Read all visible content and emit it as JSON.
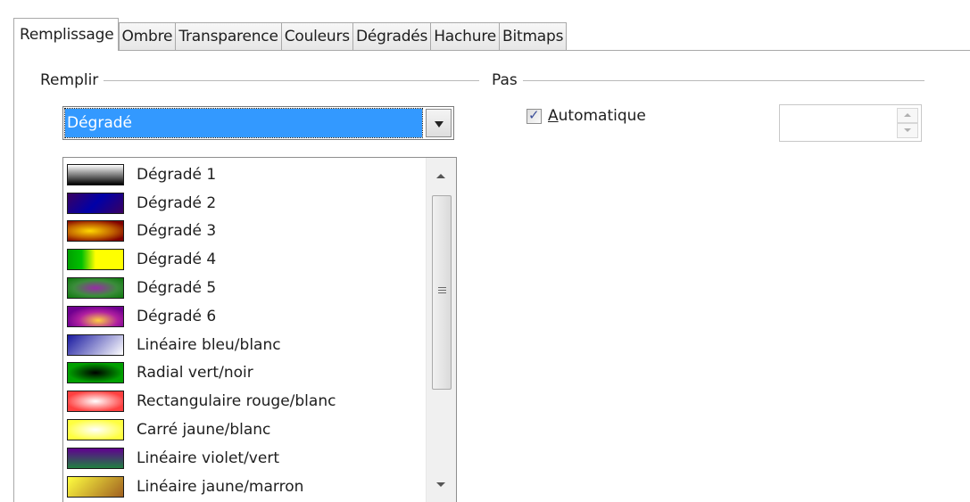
{
  "tabs": [
    {
      "label": "Remplissage",
      "active": true
    },
    {
      "label": "Ombre",
      "active": false
    },
    {
      "label": "Transparence",
      "active": false
    },
    {
      "label": "Couleurs",
      "active": false
    },
    {
      "label": "Dégradés",
      "active": false
    },
    {
      "label": "Hachure",
      "active": false
    },
    {
      "label": "Bitmaps",
      "active": false
    }
  ],
  "fill": {
    "section_label": "Remplir",
    "selected": "Dégradé",
    "items": [
      {
        "label": "Dégradé 1"
      },
      {
        "label": "Dégradé 2"
      },
      {
        "label": "Dégradé 3"
      },
      {
        "label": "Dégradé 4"
      },
      {
        "label": "Dégradé 5"
      },
      {
        "label": "Dégradé 6"
      },
      {
        "label": "Linéaire bleu/blanc"
      },
      {
        "label": "Radial vert/noir"
      },
      {
        "label": "Rectangulaire rouge/blanc"
      },
      {
        "label": "Carré jaune/blanc"
      },
      {
        "label": "Linéaire violet/vert"
      },
      {
        "label": "Linéaire jaune/marron"
      }
    ]
  },
  "step": {
    "section_label": "Pas",
    "auto_mnemonic": "A",
    "auto_rest": "utomatique",
    "auto_checked": true,
    "value": ""
  },
  "colors": {
    "selection": "#3399ff",
    "checkmark": "#3c4f9a"
  }
}
